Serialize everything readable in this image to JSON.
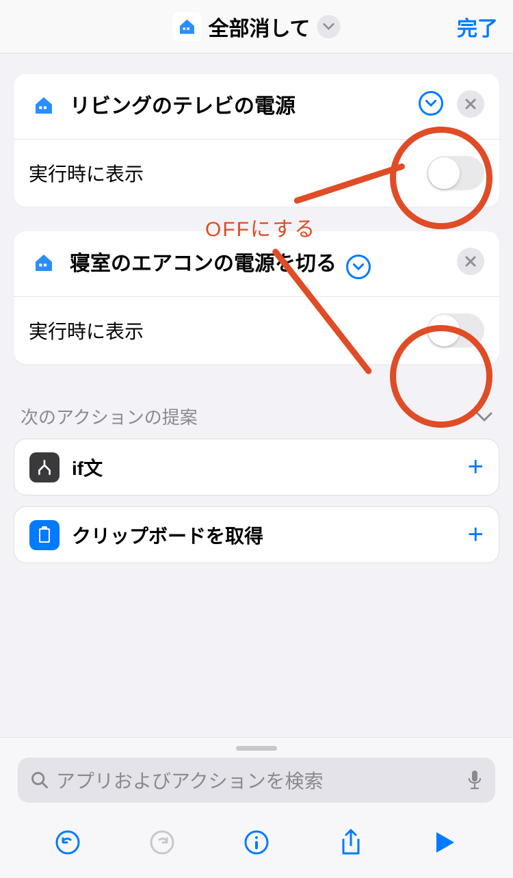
{
  "header": {
    "title": "全部消して",
    "done": "完了"
  },
  "actions": [
    {
      "title": "リビングのテレビの電源",
      "show_label": "実行時に表示"
    },
    {
      "title": "寝室のエアコンの電源を切る",
      "show_label": "実行時に表示"
    }
  ],
  "suggestions": {
    "title": "次のアクションの提案",
    "items": [
      {
        "label": "if文"
      },
      {
        "label": "クリップボードを取得"
      }
    ]
  },
  "search": {
    "placeholder": "アプリおよびアクションを検索"
  },
  "annotation": {
    "label": "OFFにする"
  }
}
